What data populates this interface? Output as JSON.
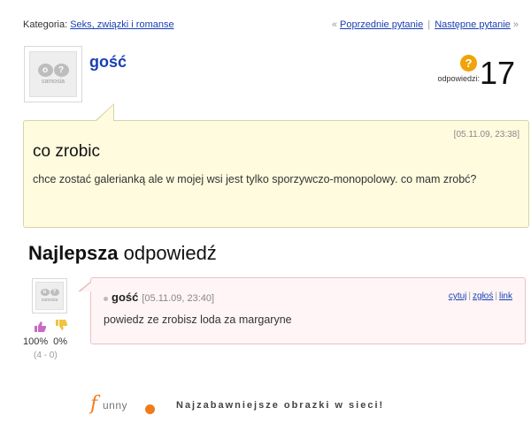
{
  "topbar": {
    "category_label": "Kategoria:",
    "category_link": "Seks, związki i romanse",
    "prev_guillemet": "«",
    "prev_link": "Poprzednie pytanie",
    "separator": "|",
    "next_link": "Następne pytanie",
    "next_guillemet": "»"
  },
  "question": {
    "avatar_brand": "samosia",
    "avatar_glyphs": [
      "o",
      "?"
    ],
    "author": "gość",
    "answers_label": "odpowiedzi:",
    "answers_count": "17",
    "answers_icon": "question-badge-icon",
    "date": "[05.11.09, 23:38]",
    "title": "co zrobic",
    "text": "chce zostać galerianką ale w mojej wsi jest tylko sporzywczo-monopolowy. co mam zrobć?"
  },
  "best_answer": {
    "heading_bold": "Najlepsza",
    "heading_rest": " odpowiedź",
    "avatar_brand": "samosia",
    "avatar_glyphs": [
      "o",
      "?"
    ],
    "votes": {
      "up_percent": "100%",
      "down_percent": "0%",
      "ratio": "(4 - 0)"
    },
    "author": "gość",
    "date": "[05.11.09, 23:40]",
    "actions": [
      "cytuj",
      "zgłoś",
      "link"
    ],
    "action_separator": "|",
    "text": "powiedz ze zrobisz loda za margaryne"
  },
  "footer": {
    "logo_initial": "f",
    "logo_rest": "unny",
    "tagline": "Najzabawniejsze obrazki w sieci!"
  },
  "colors": {
    "link": "#1a3fb3",
    "question_bg": "#fffbdf",
    "answer_bg": "#fff5f6",
    "accent_orange": "#f07b1b",
    "badge": "#f0a30a"
  }
}
